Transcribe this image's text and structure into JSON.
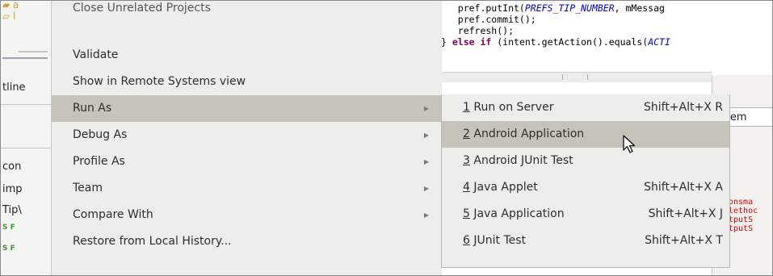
{
  "left_panel": {
    "tab_outline": "tline",
    "item_con": "con",
    "item_imp": "imp",
    "item_tip": "Tip\\",
    "static_field_marker": "S F"
  },
  "code_editor": {
    "lines": [
      {
        "pre": "   pref.putInt(",
        "italic": "PREFS_TIP_NUMBER",
        "post": ", mMessag"
      },
      {
        "pre": "   pref.commit();",
        "italic": "",
        "post": ""
      },
      {
        "pre": "   refresh();",
        "italic": "",
        "post": ""
      },
      {
        "pre": "} ",
        "bold": "else if",
        "post": " (intent.getAction().equals(",
        "italic2": "ACTI"
      }
    ]
  },
  "right_panel": {
    "tab": "oblem",
    "ar": "ar",
    "errors": [
      "onsma",
      "lethoc",
      "tputS",
      "tputS"
    ]
  },
  "context_menu": {
    "items": [
      {
        "label": "Close Unrelated Projects",
        "has_submenu": false
      },
      {
        "label": "Validate",
        "has_submenu": false
      },
      {
        "label": "Show in Remote Systems view",
        "has_submenu": false
      },
      {
        "label": "Run As",
        "has_submenu": true,
        "active": true
      },
      {
        "label": "Debug As",
        "has_submenu": true
      },
      {
        "label": "Profile As",
        "has_submenu": true
      },
      {
        "label": "Team",
        "has_submenu": true
      },
      {
        "label": "Compare With",
        "has_submenu": true
      },
      {
        "label": "Restore from Local History...",
        "has_submenu": false
      }
    ],
    "submenu_arrow": "▶"
  },
  "run_as_submenu": {
    "items": [
      {
        "num": "1",
        "label": " Run on Server",
        "shortcut": "Shift+Alt+X R"
      },
      {
        "num": "2",
        "label": " Android Application",
        "shortcut": "",
        "active": true
      },
      {
        "num": "3",
        "label": " Android JUnit Test",
        "shortcut": ""
      },
      {
        "num": "4",
        "label": " Java Applet",
        "shortcut": "Shift+Alt+X A"
      },
      {
        "num": "5",
        "label": " Java Application",
        "shortcut": "Shift+Alt+X J"
      },
      {
        "num": "6",
        "label": " JUnit Test",
        "shortcut": "Shift+Alt+X T"
      }
    ]
  },
  "colors": {
    "menu_bg": "#ededec",
    "highlight_bg": "#c6c3bb",
    "error_text": "#dd0000",
    "code_italic": "#0000c0",
    "keyword": "#7f0055"
  }
}
